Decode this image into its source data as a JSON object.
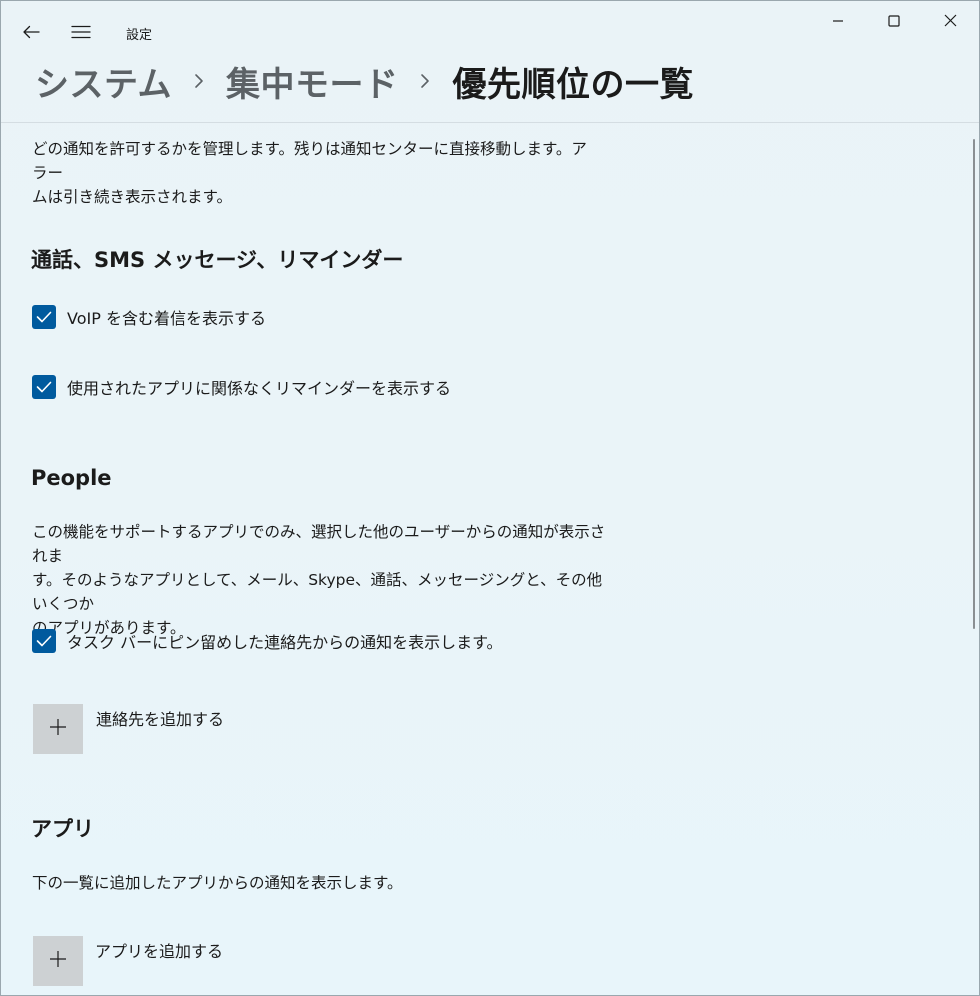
{
  "window": {
    "title": "設定",
    "icons": {
      "back": "back-arrow-icon",
      "menu": "hamburger-menu-icon",
      "minimize": "minimize-icon",
      "maximize": "maximize-icon",
      "close": "close-icon"
    }
  },
  "breadcrumb": {
    "items": [
      "システム",
      "集中モード",
      "優先順位の一覧"
    ],
    "separator_icon": "chevron-right-icon"
  },
  "intro": {
    "line1": "どの通知を許可するかを管理します。残りは通知センターに直接移動します。アラー",
    "line2": "ムは引き続き表示されます。"
  },
  "calls_section": {
    "heading": "通話、SMS メッセージ、リマインダー",
    "options": [
      {
        "label": "VoIP を含む着信を表示する",
        "checked": true
      },
      {
        "label": "使用されたアプリに関係なくリマインダーを表示する",
        "checked": true
      }
    ]
  },
  "people_section": {
    "heading": "People",
    "description": {
      "line1": "この機能をサポートするアプリでのみ、選択した他のユーザーからの通知が表示されま",
      "line2": "す。そのようなアプリとして、メール、Skype、通話、メッセージングと、その他いくつか",
      "line3": "のアプリがあります。"
    },
    "option": {
      "label": "タスク バーにピン留めした連絡先からの通知を表示します。",
      "checked": true
    },
    "add_button": {
      "label": "連絡先を追加する",
      "icon": "plus-icon"
    }
  },
  "apps_section": {
    "heading": "アプリ",
    "description": "下の一覧に追加したアプリからの通知を表示します。",
    "add_button": {
      "label": "アプリを追加する",
      "icon": "plus-icon"
    }
  },
  "colors": {
    "accent": "#005a9e",
    "background": "#eaf4f8",
    "tile": "#cdd1d3",
    "breadcrumb_parent": "#5c6266"
  }
}
